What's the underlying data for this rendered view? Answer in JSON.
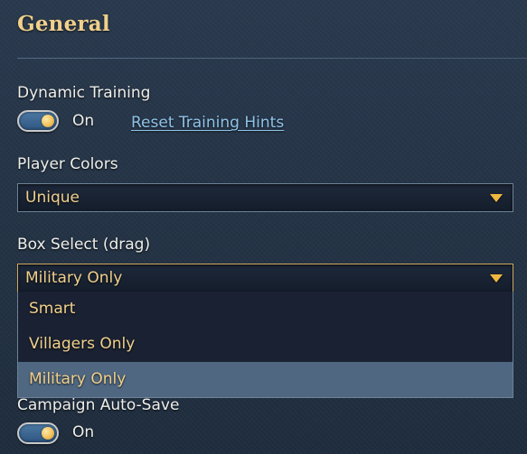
{
  "section": {
    "title": "General"
  },
  "dynamic_training": {
    "label": "Dynamic Training",
    "toggle_state": "On",
    "reset_link": "Reset Training Hints"
  },
  "player_colors": {
    "label": "Player Colors",
    "value": "Unique"
  },
  "box_select": {
    "label": "Box Select (drag)",
    "value": "Military Only",
    "options": [
      "Smart",
      "Villagers Only",
      "Military Only"
    ],
    "selected_option": "Military Only"
  },
  "campaign_autosave": {
    "label": "Campaign Auto-Save",
    "toggle_state": "On"
  },
  "colors": {
    "accent_gold": "#f0d08c",
    "link_blue": "#8fc3e8",
    "toggle_blue": "#3c6792",
    "selected_option_bg": "#4f6781"
  },
  "icons": {
    "dropdown_arrow": "chevron-down-icon",
    "toggle_knob": "toggle-knob-icon"
  }
}
